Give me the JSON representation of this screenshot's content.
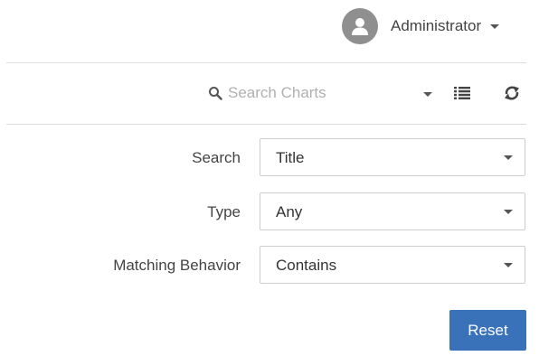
{
  "header": {
    "user_name": "Administrator",
    "avatar_icon": "user-icon",
    "dropdown_icon": "caret-down-icon"
  },
  "toolbar": {
    "search_placeholder": "Search Charts",
    "search_value": "",
    "search_icon": "search-icon",
    "filter_toggle_icon": "caret-down-icon",
    "list_view_icon": "list-icon",
    "refresh_icon": "refresh-icon"
  },
  "filters": {
    "search": {
      "label": "Search",
      "selected": "Title"
    },
    "type": {
      "label": "Type",
      "selected": "Any"
    },
    "matching": {
      "label": "Matching Behavior",
      "selected": "Contains"
    }
  },
  "actions": {
    "reset_label": "Reset"
  },
  "colors": {
    "accent": "#3a72ba",
    "avatar": "#8f8f8f",
    "divider": "#dddddd",
    "placeholder": "#b0b0b0"
  }
}
